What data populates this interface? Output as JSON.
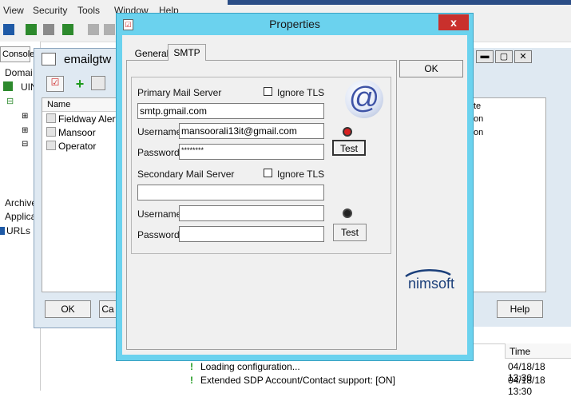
{
  "menubar": {
    "items": [
      "View",
      "Security",
      "Tools",
      "Window",
      "Help"
    ]
  },
  "console": {
    "tab_label": "Console",
    "domain_label": "Domai",
    "uim_label": "UIN",
    "archive_label": "Archive",
    "applica_label": "Applica",
    "urls_label": "URLs"
  },
  "email_window": {
    "title": "emailgtw",
    "column_name": "Name",
    "rows": [
      "Fieldway Alert",
      "Mansoor",
      "Operator"
    ],
    "ok_label": "OK",
    "cancel_label": "Ca"
  },
  "right_window": {
    "col_label": "te",
    "row1": "on",
    "row2": "on",
    "help_label": "Help"
  },
  "log": {
    "time_header": "Time",
    "entries": [
      {
        "text": "Loading configuration...",
        "time": "04/18/18 13:30"
      },
      {
        "text": "Extended SDP Account/Contact support: [ON]",
        "time": "04/18/18 13:30"
      }
    ]
  },
  "dialog": {
    "title": "Properties",
    "close_label": "x",
    "tabs": [
      "General",
      "SMTP"
    ],
    "active_tab": "SMTP",
    "ok_label": "OK",
    "primary": {
      "label": "Primary Mail Server",
      "ignore_tls_label": "Ignore TLS",
      "server_value": "smtp.gmail.com",
      "username_label": "Username",
      "username_value": "mansoorali13it@gmail.com",
      "password_label": "Password",
      "password_value": "********",
      "test_label": "Test",
      "status_color": "#d62020"
    },
    "secondary": {
      "label": "Secondary Mail Server",
      "ignore_tls_label": "Ignore TLS",
      "server_value": "",
      "username_label": "Username",
      "username_value": "",
      "password_label": "Password",
      "password_value": "",
      "test_label": "Test",
      "status_color": "#222222"
    },
    "logo_text": "nimsoft",
    "at_icon": "@"
  }
}
